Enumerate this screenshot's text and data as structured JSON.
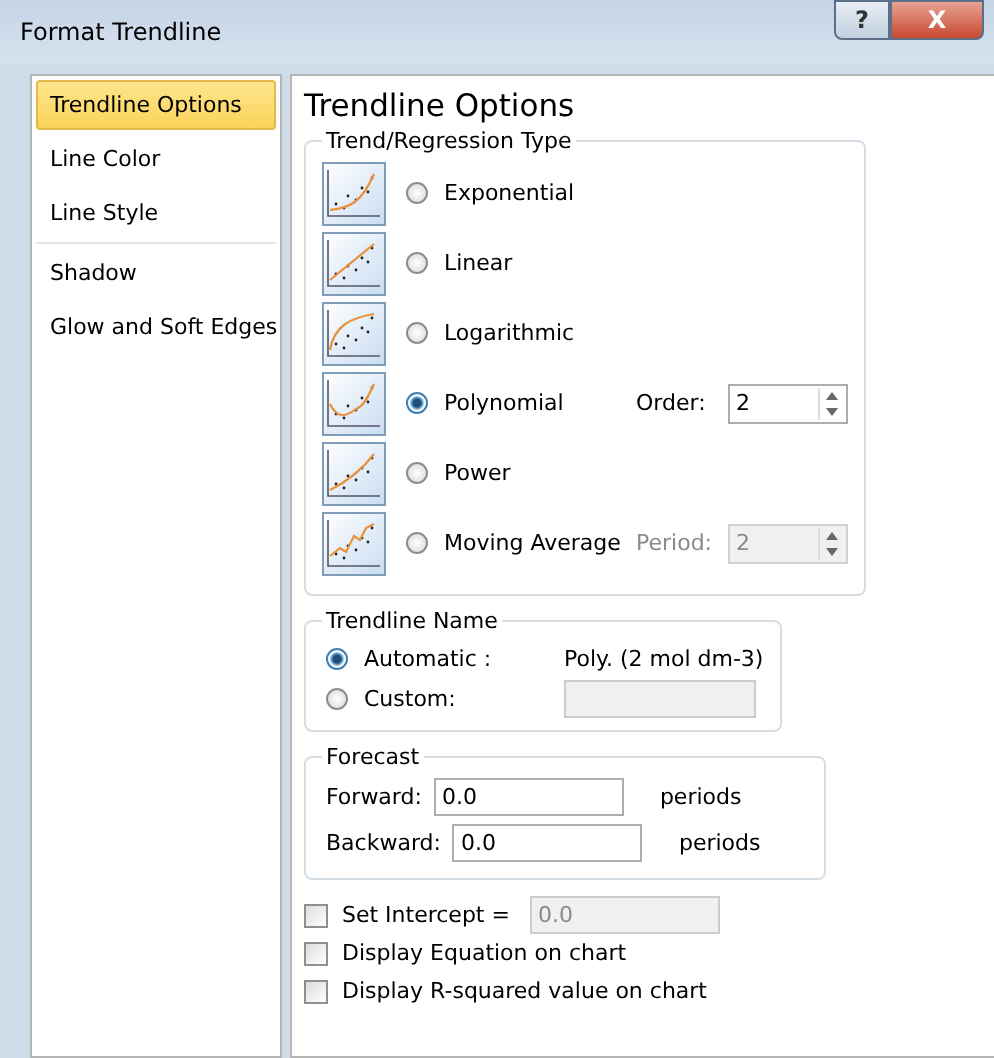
{
  "window": {
    "title": "Format Trendline",
    "help_button": "?",
    "close_button": "X"
  },
  "sidebar": {
    "groups": [
      [
        {
          "label": "Trendline Options",
          "selected": true
        },
        {
          "label": "Line Color",
          "selected": false
        },
        {
          "label": "Line Style",
          "selected": false
        }
      ],
      [
        {
          "label": "Shadow",
          "selected": false
        },
        {
          "label": "Glow and Soft Edges",
          "selected": false
        }
      ]
    ]
  },
  "heading": "Trendline Options",
  "trend_type": {
    "title": "Trend/Regression Type",
    "options": [
      {
        "kind": "exponential",
        "label": "Exponential",
        "selected": false
      },
      {
        "kind": "linear",
        "label": "Linear",
        "selected": false
      },
      {
        "kind": "logarithmic",
        "label": "Logarithmic",
        "selected": false
      },
      {
        "kind": "polynomial",
        "label": "Polynomial",
        "selected": true,
        "extra": {
          "label": "Order:",
          "value": "2",
          "disabled": false
        }
      },
      {
        "kind": "power",
        "label": "Power",
        "selected": false
      },
      {
        "kind": "moving_average",
        "label": "Moving Average",
        "selected": false,
        "extra": {
          "label": "Period:",
          "value": "2",
          "disabled": true
        }
      }
    ]
  },
  "trendline_name": {
    "title": "Trendline Name",
    "options": [
      {
        "label": "Automatic :",
        "selected": true,
        "value": "Poly. (2 mol dm-3)"
      },
      {
        "label": "Custom:",
        "selected": false
      }
    ]
  },
  "forecast": {
    "title": "Forecast",
    "rows": [
      {
        "label": "Forward:",
        "value": "0.0",
        "unit": "periods"
      },
      {
        "label": "Backward:",
        "value": "0.0",
        "unit": "periods"
      }
    ]
  },
  "checks": [
    {
      "label": "Set Intercept =",
      "checked": false,
      "value": "0.0"
    },
    {
      "label": "Display Equation on chart",
      "checked": false
    },
    {
      "label": "Display R-squared value on chart",
      "checked": false
    }
  ]
}
